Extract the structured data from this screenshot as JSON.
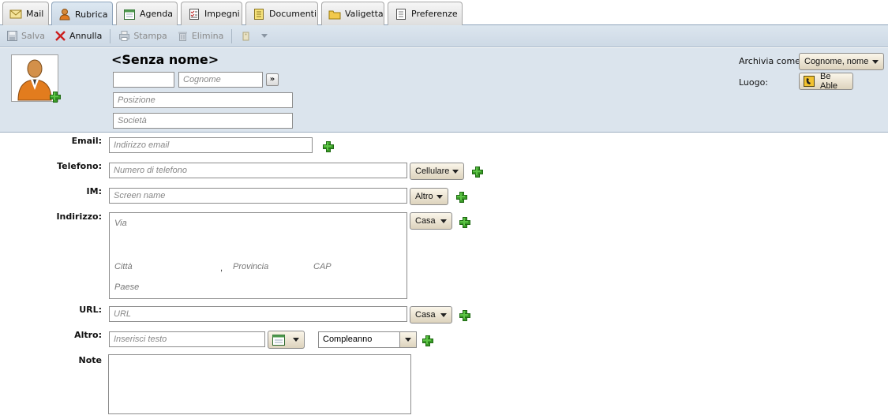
{
  "tabs": [
    {
      "label": "Mail",
      "icon": "envelope-icon"
    },
    {
      "label": "Rubrica",
      "icon": "contact-icon"
    },
    {
      "label": "Agenda",
      "icon": "calendar-icon"
    },
    {
      "label": "Impegni",
      "icon": "tasks-icon"
    },
    {
      "label": "Documenti",
      "icon": "notebook-icon"
    },
    {
      "label": "Valigetta",
      "icon": "folder-icon"
    },
    {
      "label": "Preferenze",
      "icon": "preferences-icon"
    }
  ],
  "active_tab": "Rubrica",
  "toolbar": {
    "save": "Salva",
    "cancel": "Annulla",
    "print": "Stampa",
    "delete": "Elimina"
  },
  "header": {
    "name_title": "<Senza nome>",
    "first_name_value": "",
    "last_name_placeholder": "Cognome",
    "expand_button": "»",
    "position_placeholder": "Posizione",
    "company_placeholder": "Società",
    "file_as_label": "Archivia come:",
    "file_as_value": "Cognome, nome",
    "location_label": "Luogo:",
    "location_value": "Be Able"
  },
  "form": {
    "email_label": "Email:",
    "email_placeholder": "Indirizzo email",
    "phone_label": "Telefono:",
    "phone_placeholder": "Numero di telefono",
    "phone_type": "Cellulare",
    "im_label": "IM:",
    "im_placeholder": "Screen name",
    "im_type": "Altro",
    "address_label": "Indirizzo:",
    "address_type": "Casa",
    "street_placeholder": "Via",
    "city_placeholder": "Città",
    "comma": ",",
    "province_placeholder": "Provincia",
    "zip_placeholder": "CAP",
    "country_placeholder": "Paese",
    "url_label": "URL:",
    "url_placeholder": "URL",
    "url_type": "Casa",
    "other_label": "Altro:",
    "other_placeholder": "Inserisci testo",
    "other_type": "Compleanno",
    "notes_label": "Note"
  },
  "colors": {
    "header_bg": "#dbe4ed",
    "add_green": "#3a9a27"
  }
}
